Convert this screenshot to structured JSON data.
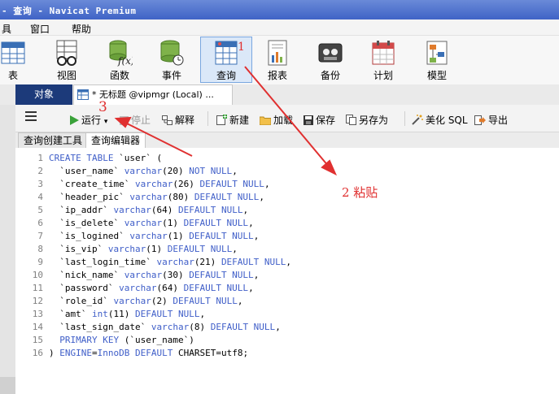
{
  "window": {
    "title": "- 查询 - Navicat Premium"
  },
  "menu": [
    "具",
    "窗口",
    "帮助"
  ],
  "ribbon": [
    {
      "label": "表",
      "icon": "table-icon"
    },
    {
      "label": "视图",
      "icon": "view-icon"
    },
    {
      "label": "函数",
      "icon": "function-icon"
    },
    {
      "label": "事件",
      "icon": "event-icon"
    },
    {
      "label": "查询",
      "icon": "query-icon"
    },
    {
      "label": "报表",
      "icon": "report-icon"
    },
    {
      "label": "备份",
      "icon": "backup-icon"
    },
    {
      "label": "计划",
      "icon": "schedule-icon"
    },
    {
      "label": "模型",
      "icon": "model-icon"
    }
  ],
  "tabs": {
    "objects": "对象",
    "query": "* 无标题 @vipmgr (Local) ..."
  },
  "toolbar": {
    "run": "运行",
    "stop": "停止",
    "explain": "解释",
    "new": "新建",
    "load": "加载",
    "save": "保存",
    "save_as": "另存为",
    "beautify": "美化 SQL",
    "export": "导出"
  },
  "subtabs": {
    "builder": "查询创建工具",
    "editor": "查询编辑器"
  },
  "code_lines": [
    [
      [
        "kw",
        "CREATE TABLE "
      ],
      [
        "tx",
        "`user` ("
      ]
    ],
    [
      [
        "tx",
        "  `user_name` "
      ],
      [
        "kw",
        "varchar"
      ],
      [
        "tx",
        "(20) "
      ],
      [
        "kw",
        "NOT NULL"
      ],
      [
        "tx",
        ","
      ]
    ],
    [
      [
        "tx",
        "  `create_time` "
      ],
      [
        "kw",
        "varchar"
      ],
      [
        "tx",
        "(26) "
      ],
      [
        "kw",
        "DEFAULT NULL"
      ],
      [
        "tx",
        ","
      ]
    ],
    [
      [
        "tx",
        "  `header_pic` "
      ],
      [
        "kw",
        "varchar"
      ],
      [
        "tx",
        "(80) "
      ],
      [
        "kw",
        "DEFAULT NULL"
      ],
      [
        "tx",
        ","
      ]
    ],
    [
      [
        "tx",
        "  `ip_addr` "
      ],
      [
        "kw",
        "varchar"
      ],
      [
        "tx",
        "(64) "
      ],
      [
        "kw",
        "DEFAULT NULL"
      ],
      [
        "tx",
        ","
      ]
    ],
    [
      [
        "tx",
        "  `is_delete` "
      ],
      [
        "kw",
        "varchar"
      ],
      [
        "tx",
        "(1) "
      ],
      [
        "kw",
        "DEFAULT NULL"
      ],
      [
        "tx",
        ","
      ]
    ],
    [
      [
        "tx",
        "  `is_logined` "
      ],
      [
        "kw",
        "varchar"
      ],
      [
        "tx",
        "(1) "
      ],
      [
        "kw",
        "DEFAULT NULL"
      ],
      [
        "tx",
        ","
      ]
    ],
    [
      [
        "tx",
        "  `is_vip` "
      ],
      [
        "kw",
        "varchar"
      ],
      [
        "tx",
        "(1) "
      ],
      [
        "kw",
        "DEFAULT NULL"
      ],
      [
        "tx",
        ","
      ]
    ],
    [
      [
        "tx",
        "  `last_login_time` "
      ],
      [
        "kw",
        "varchar"
      ],
      [
        "tx",
        "(21) "
      ],
      [
        "kw",
        "DEFAULT NULL"
      ],
      [
        "tx",
        ","
      ]
    ],
    [
      [
        "tx",
        "  `nick_name` "
      ],
      [
        "kw",
        "varchar"
      ],
      [
        "tx",
        "(30) "
      ],
      [
        "kw",
        "DEFAULT NULL"
      ],
      [
        "tx",
        ","
      ]
    ],
    [
      [
        "tx",
        "  `password` "
      ],
      [
        "kw",
        "varchar"
      ],
      [
        "tx",
        "(64) "
      ],
      [
        "kw",
        "DEFAULT NULL"
      ],
      [
        "tx",
        ","
      ]
    ],
    [
      [
        "tx",
        "  `role_id` "
      ],
      [
        "kw",
        "varchar"
      ],
      [
        "tx",
        "(2) "
      ],
      [
        "kw",
        "DEFAULT NULL"
      ],
      [
        "tx",
        ","
      ]
    ],
    [
      [
        "tx",
        "  `amt` "
      ],
      [
        "kw",
        "int"
      ],
      [
        "tx",
        "(11) "
      ],
      [
        "kw",
        "DEFAULT NULL"
      ],
      [
        "tx",
        ","
      ]
    ],
    [
      [
        "tx",
        "  `last_sign_date` "
      ],
      [
        "kw",
        "varchar"
      ],
      [
        "tx",
        "(8) "
      ],
      [
        "kw",
        "DEFAULT NULL"
      ],
      [
        "tx",
        ","
      ]
    ],
    [
      [
        "kw",
        "  PRIMARY KEY "
      ],
      [
        "tx",
        "(`user_name`)"
      ]
    ],
    [
      [
        "tx",
        ") "
      ],
      [
        "kw",
        "ENGINE"
      ],
      [
        "tx",
        "="
      ],
      [
        "kw",
        "InnoDB DEFAULT "
      ],
      [
        "tx",
        "CHARSET=utf8;"
      ]
    ]
  ],
  "annotations": {
    "one": "1",
    "two": "2 粘贴",
    "three": "3"
  },
  "colors": {
    "keyword": "#3f5ec8",
    "annotation": "#e03030",
    "title_bar": "#3f63c6"
  }
}
